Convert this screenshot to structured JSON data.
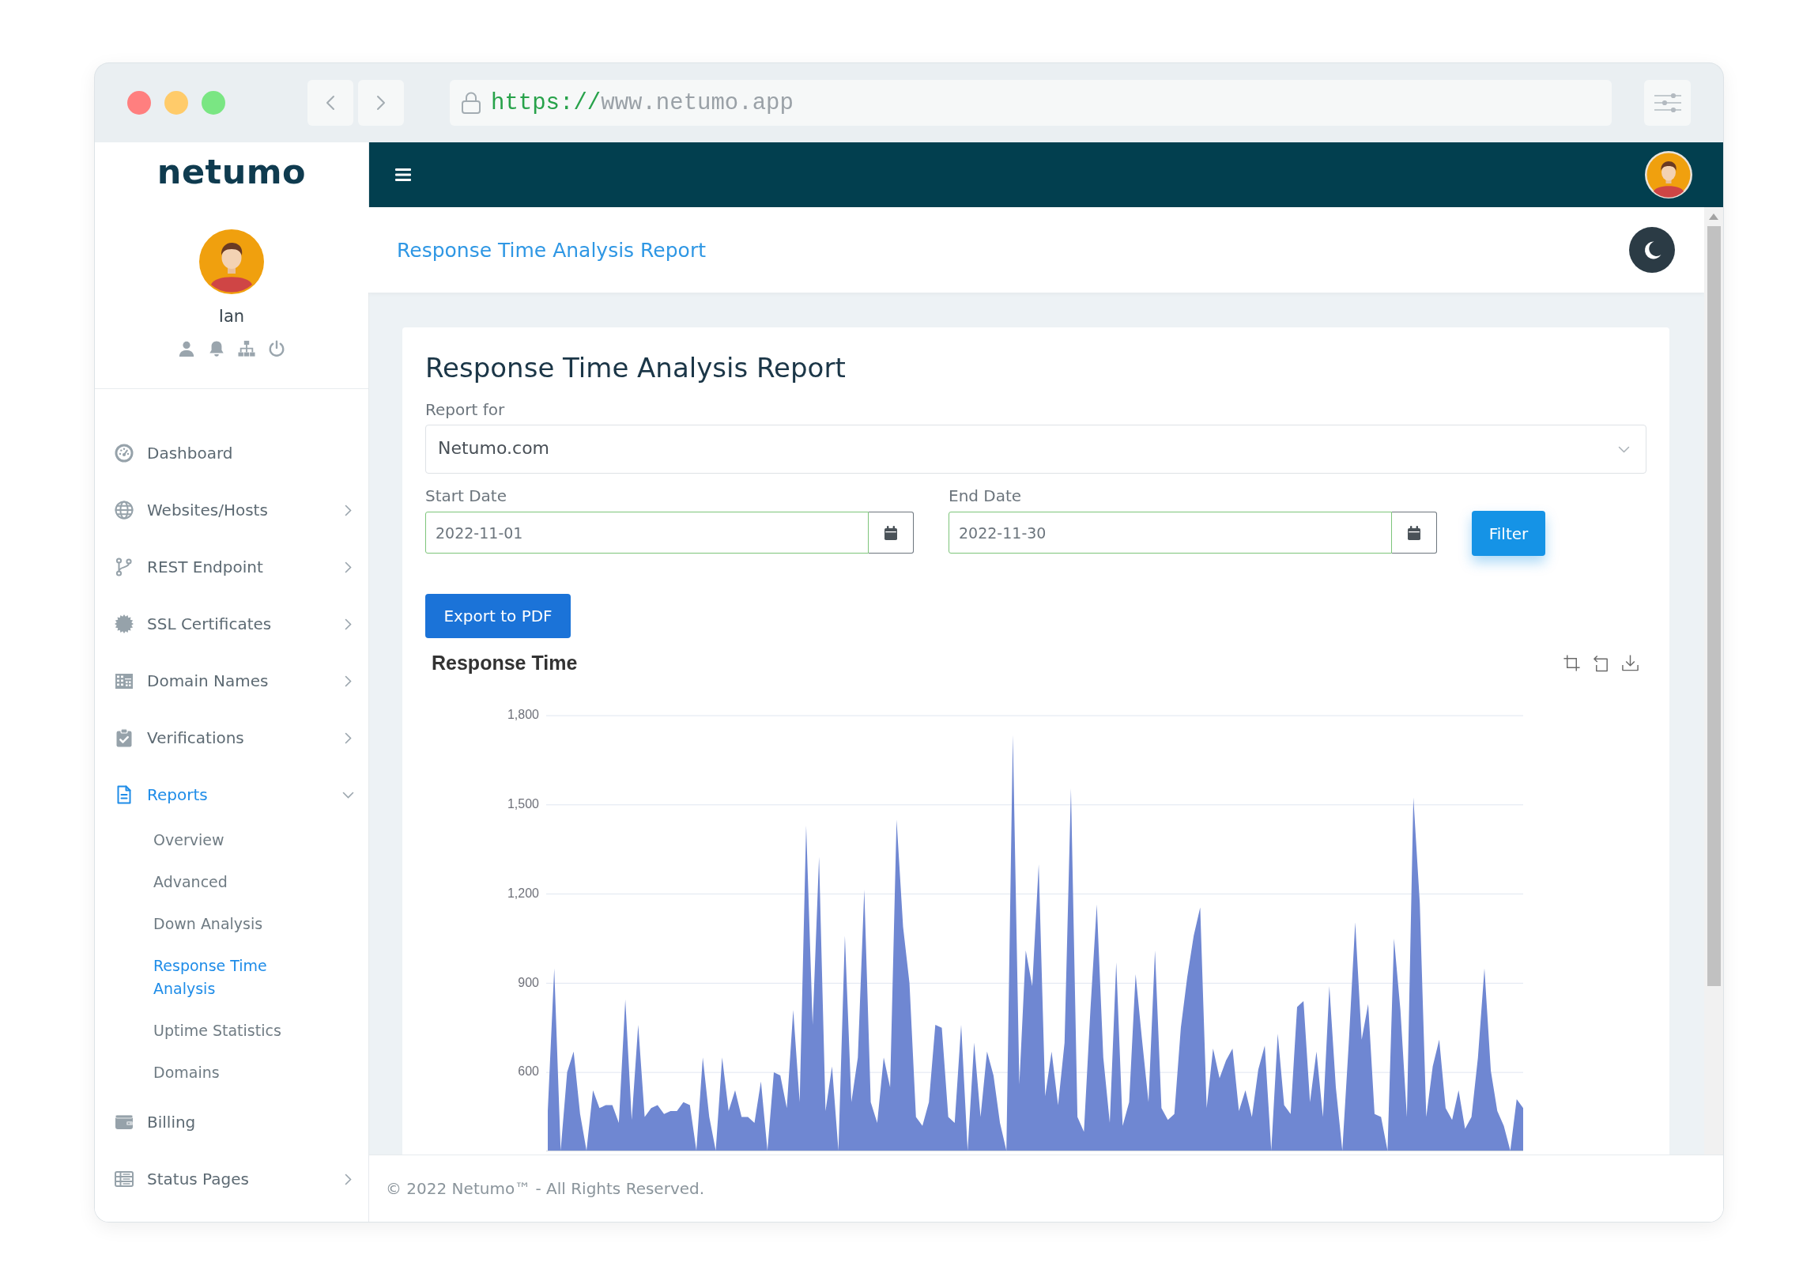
{
  "browser": {
    "url": {
      "scheme": "https://",
      "host": "www.netumo.app"
    }
  },
  "sidebar": {
    "logo": "netumo",
    "user": {
      "name": "Ian"
    },
    "menu": [
      {
        "label": "Dashboard",
        "kind": "link",
        "selected": false
      },
      {
        "label": "Websites/Hosts",
        "kind": "group",
        "expanded": false,
        "selected": false
      },
      {
        "label": "REST Endpoint",
        "kind": "group",
        "expanded": false,
        "selected": false
      },
      {
        "label": "SSL Certificates",
        "kind": "group",
        "expanded": false,
        "selected": false
      },
      {
        "label": "Domain Names",
        "kind": "group",
        "expanded": false,
        "selected": false
      },
      {
        "label": "Verifications",
        "kind": "group",
        "expanded": false,
        "selected": false
      },
      {
        "label": "Reports",
        "kind": "group",
        "expanded": true,
        "selected": true,
        "children": [
          {
            "label": "Overview",
            "selected": false
          },
          {
            "label": "Advanced",
            "selected": false
          },
          {
            "label": "Down Analysis",
            "selected": false
          },
          {
            "label": "Response Time Analysis",
            "selected": true
          },
          {
            "label": "Uptime Statistics",
            "selected": false
          },
          {
            "label": "Domains",
            "selected": false
          }
        ]
      },
      {
        "label": "Billing",
        "kind": "link",
        "selected": false
      },
      {
        "label": "Status Pages",
        "kind": "group",
        "expanded": false,
        "selected": false
      }
    ]
  },
  "page_header": {
    "title": "Response Time Analysis Report"
  },
  "report": {
    "title": "Response Time Analysis Report",
    "report_for": {
      "label": "Report for",
      "value": "Netumo.com"
    },
    "start_date": {
      "label": "Start Date",
      "value": "2022-11-01",
      "valid": true
    },
    "end_date": {
      "label": "End Date",
      "value": "2022-11-30",
      "valid": true
    },
    "filter_button": "Filter",
    "export_button": "Export to PDF",
    "chart": {
      "chart_data": {
        "type": "area",
        "title": "Response Time",
        "ylim": [
          337,
          1800
        ],
        "yticks": [
          600,
          900,
          {
            "value": 1200,
            "label": "1,200"
          },
          {
            "value": 1500,
            "label": "1,500"
          },
          {
            "value": 1800,
            "label": "1,800"
          }
        ],
        "grid": true,
        "values": [
          470,
          950,
          null,
          600,
          670,
          460,
          null,
          540,
          480,
          490,
          490,
          430,
          845,
          440,
          760,
          450,
          480,
          490,
          460,
          470,
          470,
          500,
          490,
          null,
          650,
          450,
          null,
          650,
          470,
          540,
          450,
          450,
          430,
          570,
          null,
          600,
          590,
          480,
          810,
          500,
          1430,
          760,
          1325,
          470,
          620,
          null,
          1060,
          500,
          650,
          1215,
          500,
          430,
          650,
          550,
          1450,
          1090,
          900,
          450,
          420,
          500,
          760,
          750,
          450,
          430,
          760,
          null,
          700,
          450,
          670,
          590,
          430,
          null,
          1735,
          560,
          1010,
          890,
          1300,
          520,
          670,
          490,
          700,
          1555,
          450,
          400,
          810,
          1165,
          650,
          430,
          970,
          420,
          500,
          930,
          710,
          500,
          1010,
          480,
          440,
          460,
          750,
          920,
          1060,
          1155,
          480,
          680,
          580,
          640,
          680,
          470,
          540,
          450,
          610,
          690,
          null,
          730,
          490,
          460,
          820,
          840,
          500,
          670,
          450,
          890,
          550,
          null,
          700,
          1105,
          710,
          830,
          460,
          450,
          null,
          1050,
          810,
          450,
          1525,
          1170,
          450,
          620,
          710,
          480,
          440,
          540,
          410,
          450,
          650,
          950,
          605,
          470,
          420,
          null,
          510,
          480
        ]
      }
    }
  },
  "footer": {
    "text": "© 2022 Netumo™ - All Rights Reserved."
  }
}
